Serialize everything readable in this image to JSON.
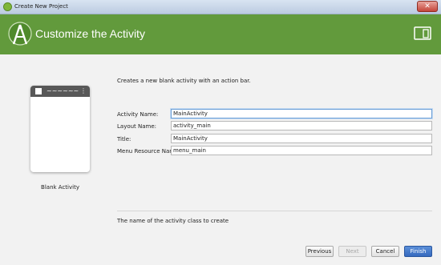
{
  "window": {
    "title": "Create New Project",
    "close_glyph": "✕",
    "app_icon": "android-studio-icon"
  },
  "header": {
    "title": "Customize the Activity",
    "logo_icon": "android-studio-logo-icon",
    "device_icon": "tablet-device-icon",
    "color": "#629a3c"
  },
  "preview": {
    "label": "Blank Activity",
    "wave_glyph": "~~~~~~",
    "menu_glyph": "⋮"
  },
  "form": {
    "description": "Creates a new blank activity with an action bar.",
    "fields": [
      {
        "label": "Activity Name:",
        "value": "MainActivity",
        "focused": true
      },
      {
        "label": "Layout Name:",
        "value": "activity_main"
      },
      {
        "label": "Title:",
        "value": "MainActivity"
      },
      {
        "label": "Menu Resource Name:",
        "value": "menu_main"
      }
    ],
    "hint": "The name of the activity class to create"
  },
  "buttons": {
    "previous": "Previous",
    "next": "Next",
    "cancel": "Cancel",
    "finish": "Finish"
  }
}
